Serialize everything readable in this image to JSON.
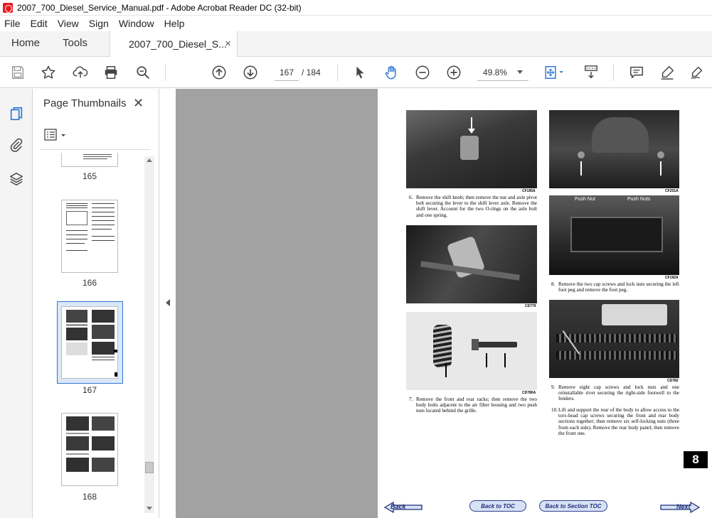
{
  "window": {
    "title": "2007_700_Diesel_Service_Manual.pdf - Adobe Acrobat Reader DC (32-bit)"
  },
  "menu": [
    "File",
    "Edit",
    "View",
    "Sign",
    "Window",
    "Help"
  ],
  "tabs": {
    "home": "Home",
    "tools": "Tools",
    "document": "2007_700_Diesel_S...",
    "close": "×"
  },
  "toolbar": {
    "page_current": "167",
    "page_total": "/ 184",
    "zoom": "49.8%",
    "icons": [
      "save-icon",
      "star-icon",
      "upload-icon",
      "print-icon",
      "zoom-search-icon",
      "page-up-icon",
      "page-down-icon",
      "cursor-icon",
      "hand-icon",
      "zoom-out-icon",
      "zoom-in-icon",
      "fit-page-icon",
      "scroll-mode-icon",
      "comment-icon",
      "highlight-icon",
      "sign-icon"
    ]
  },
  "panel": {
    "title": "Page Thumbnails",
    "close": "✕",
    "thumbnails": [
      {
        "label": "165"
      },
      {
        "label": "166"
      },
      {
        "label": "167",
        "selected": true
      },
      {
        "label": "168"
      }
    ]
  },
  "page": {
    "photos": [
      {
        "code": "CF195A"
      },
      {
        "code": "CD779"
      },
      {
        "code": "CD780A"
      },
      {
        "code": "CF201A"
      },
      {
        "code": "CF192A"
      },
      {
        "code": "CD782"
      }
    ],
    "photo_labels": {
      "push_nut_1": "Push Nut",
      "push_nut_2": "Push Nuts"
    },
    "steps": [
      {
        "num": "6.",
        "text": "Remove the shift knob; then remove the nut and axle pivot bolt securing the lever to the shift lever axle. Remove the shift lever. Account for the two O-rings on the axle bolt and one spring."
      },
      {
        "num": "7.",
        "text": "Remove the front and rear racks; then remove the two body bolts adjacent to the air filter housing and two push nuts located behind the grille."
      },
      {
        "num": "8.",
        "text": "Remove the two cap screws and lock nuts securing the left foot peg and remove the foot peg."
      },
      {
        "num": "9.",
        "text": "Remove eight cap screws and lock nuts and one reinstallable rivet securing the right-side footwell to the fenders."
      },
      {
        "num": "10.",
        "text": "Lift and support the rear of the body to allow access to the torx-head cap screws securing the front and rear body sections together; then remove six self-locking nuts (three from each side). Remove the rear body panel; then remove the front one."
      }
    ],
    "section_tab": "8",
    "nav": {
      "back": "Back",
      "toc": "Back to TOC",
      "section_toc": "Back to Section TOC",
      "next": "Next"
    }
  },
  "colors": {
    "accent": "#2d77d1",
    "doc_bg": "#a2a2a2",
    "nav_blue": "#1d2e7a"
  }
}
